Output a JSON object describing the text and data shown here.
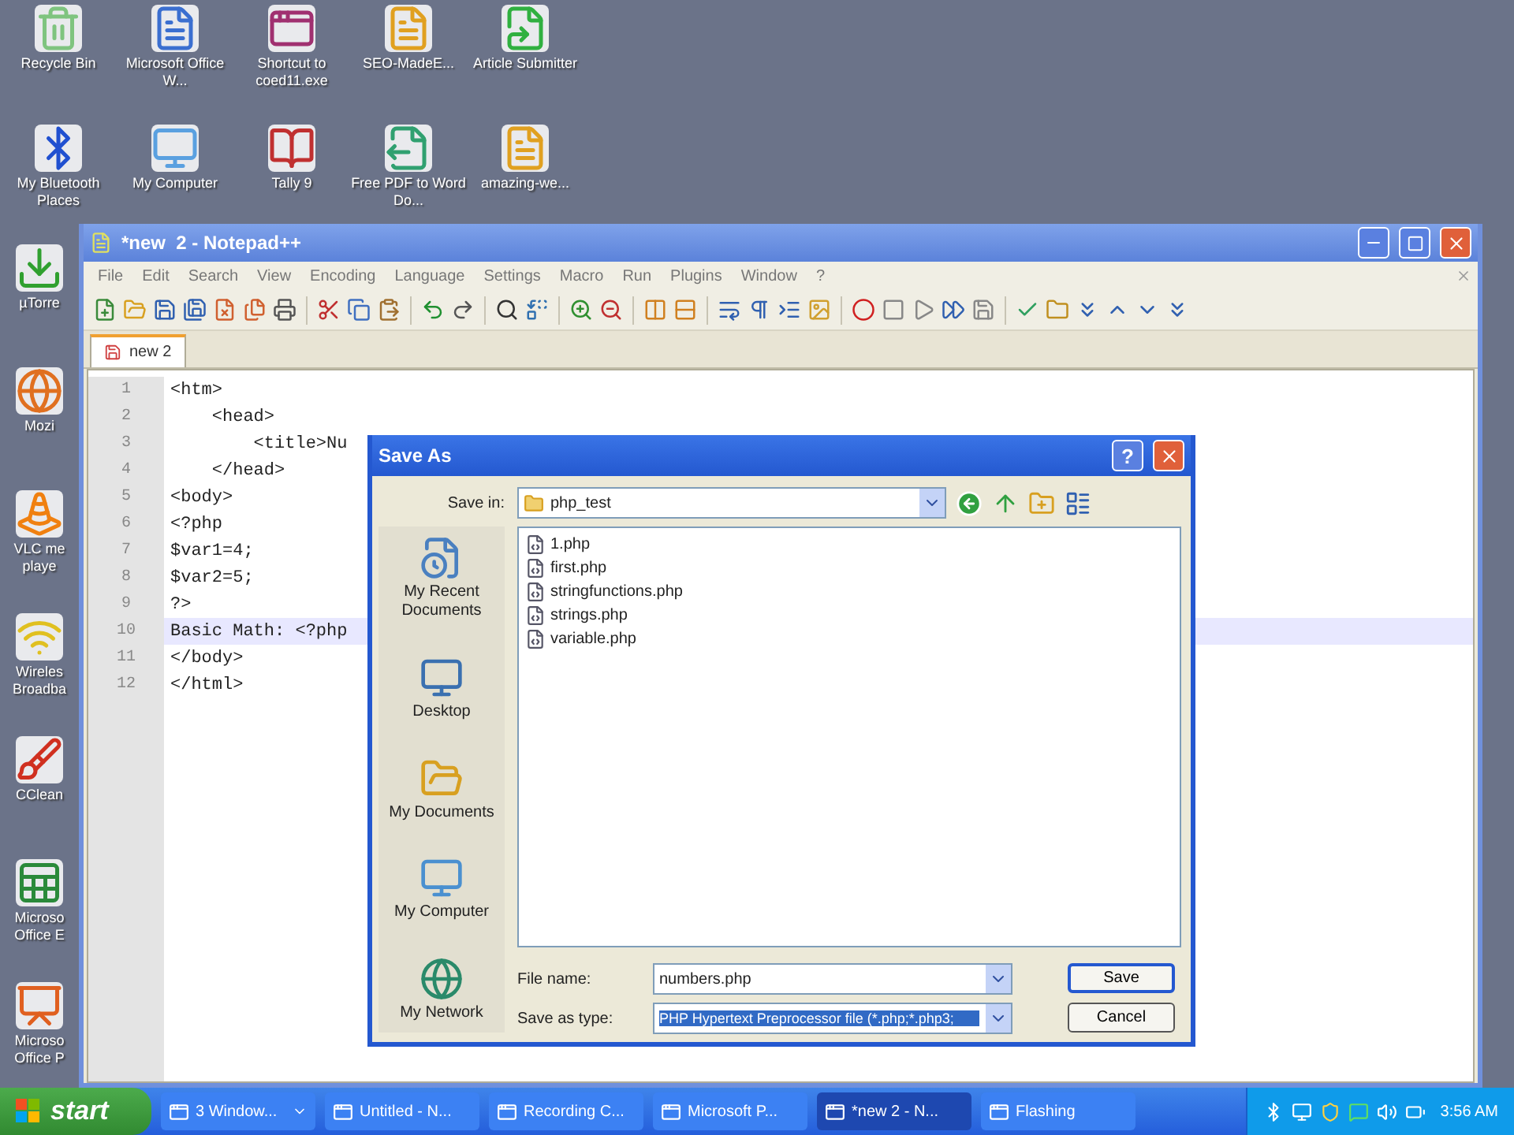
{
  "desktop": {
    "icons": [
      {
        "label": "Recycle Bin",
        "kind": "bin"
      },
      {
        "label": "Microsoft Office W...",
        "kind": "word"
      },
      {
        "label": "Shortcut to coed11.exe",
        "kind": "app"
      },
      {
        "label": "SEO-MadeE...",
        "kind": "pdf"
      },
      {
        "label": "Article Submitter",
        "kind": "arrow"
      },
      {
        "label": "My Bluetooth Places",
        "kind": "bluetooth"
      },
      {
        "label": "My Computer",
        "kind": "computer"
      },
      {
        "label": "Tally 9",
        "kind": "tally"
      },
      {
        "label": "Free PDF to Word Do...",
        "kind": "convert"
      },
      {
        "label": "amazing-we...",
        "kind": "pdf"
      }
    ],
    "side_icons": [
      {
        "label": "µTorre",
        "kind": "torrent"
      },
      {
        "label": "Mozi",
        "kind": "browser"
      },
      {
        "label": "VLC me playe",
        "kind": "vlc"
      },
      {
        "label": "Wireles Broadba",
        "kind": "wireless"
      },
      {
        "label": "CClean",
        "kind": "cleaner"
      },
      {
        "label": "Microso Office E",
        "kind": "excel"
      },
      {
        "label": "Microso Office P",
        "kind": "powerpoint"
      }
    ]
  },
  "notepad": {
    "title": "*new  2 - Notepad++",
    "menu": [
      "File",
      "Edit",
      "Search",
      "View",
      "Encoding",
      "Language",
      "Settings",
      "Macro",
      "Run",
      "Plugins",
      "Window",
      "?"
    ],
    "tabs": [
      {
        "label": "new 2",
        "selected": true
      }
    ],
    "lines": [
      {
        "number": "1",
        "text": "<htm>",
        "current": false
      },
      {
        "number": "2",
        "text": "    <head>",
        "current": false
      },
      {
        "number": "3",
        "text": "        <title>Nu",
        "current": false
      },
      {
        "number": "4",
        "text": "    </head>",
        "current": false
      },
      {
        "number": "5",
        "text": "<body>",
        "current": false
      },
      {
        "number": "6",
        "text": "<?php",
        "current": false
      },
      {
        "number": "7",
        "text": "$var1=4;",
        "current": false
      },
      {
        "number": "8",
        "text": "$var2=5;",
        "current": false
      },
      {
        "number": "9",
        "text": "?>",
        "current": false
      },
      {
        "number": "10",
        "text": "Basic Math: <?php",
        "current": true
      },
      {
        "number": "11",
        "text": "</body>",
        "current": false
      },
      {
        "number": "12",
        "text": "</html>",
        "current": false
      }
    ]
  },
  "dialog": {
    "title": "Save As",
    "help": "?",
    "save_in": {
      "label": "Save in:",
      "value": "php_test"
    },
    "places": [
      {
        "label": "My Recent Documents",
        "kind": "recent"
      },
      {
        "label": "Desktop",
        "kind": "desktop"
      },
      {
        "label": "My Documents",
        "kind": "documents"
      },
      {
        "label": "My Computer",
        "kind": "computer"
      },
      {
        "label": "My Network",
        "kind": "network"
      }
    ],
    "files": [
      "1.php",
      "first.php",
      "stringfunctions.php",
      "strings.php",
      "variable.php"
    ],
    "file_name": {
      "label": "File name:",
      "value": "numbers.php"
    },
    "save_as_type": {
      "label": "Save as type:",
      "value": "PHP Hypertext Preprocessor file (*.php;*.php3;",
      "selected": true
    },
    "buttons": [
      "Save",
      "Cancel"
    ]
  },
  "taskbar": {
    "start": "start",
    "tasks": [
      {
        "label": "3 Window...",
        "selected": false,
        "grouped": true
      },
      {
        "label": "Untitled - N...",
        "selected": false,
        "grouped": false
      },
      {
        "label": "Recording C...",
        "selected": false,
        "grouped": false
      },
      {
        "label": "Microsoft P...",
        "selected": false,
        "grouped": false
      },
      {
        "label": "*new  2 - N...",
        "selected": true,
        "grouped": false
      },
      {
        "label": "Flashing",
        "selected": false,
        "grouped": false
      }
    ],
    "clock": "3:56 AM"
  }
}
